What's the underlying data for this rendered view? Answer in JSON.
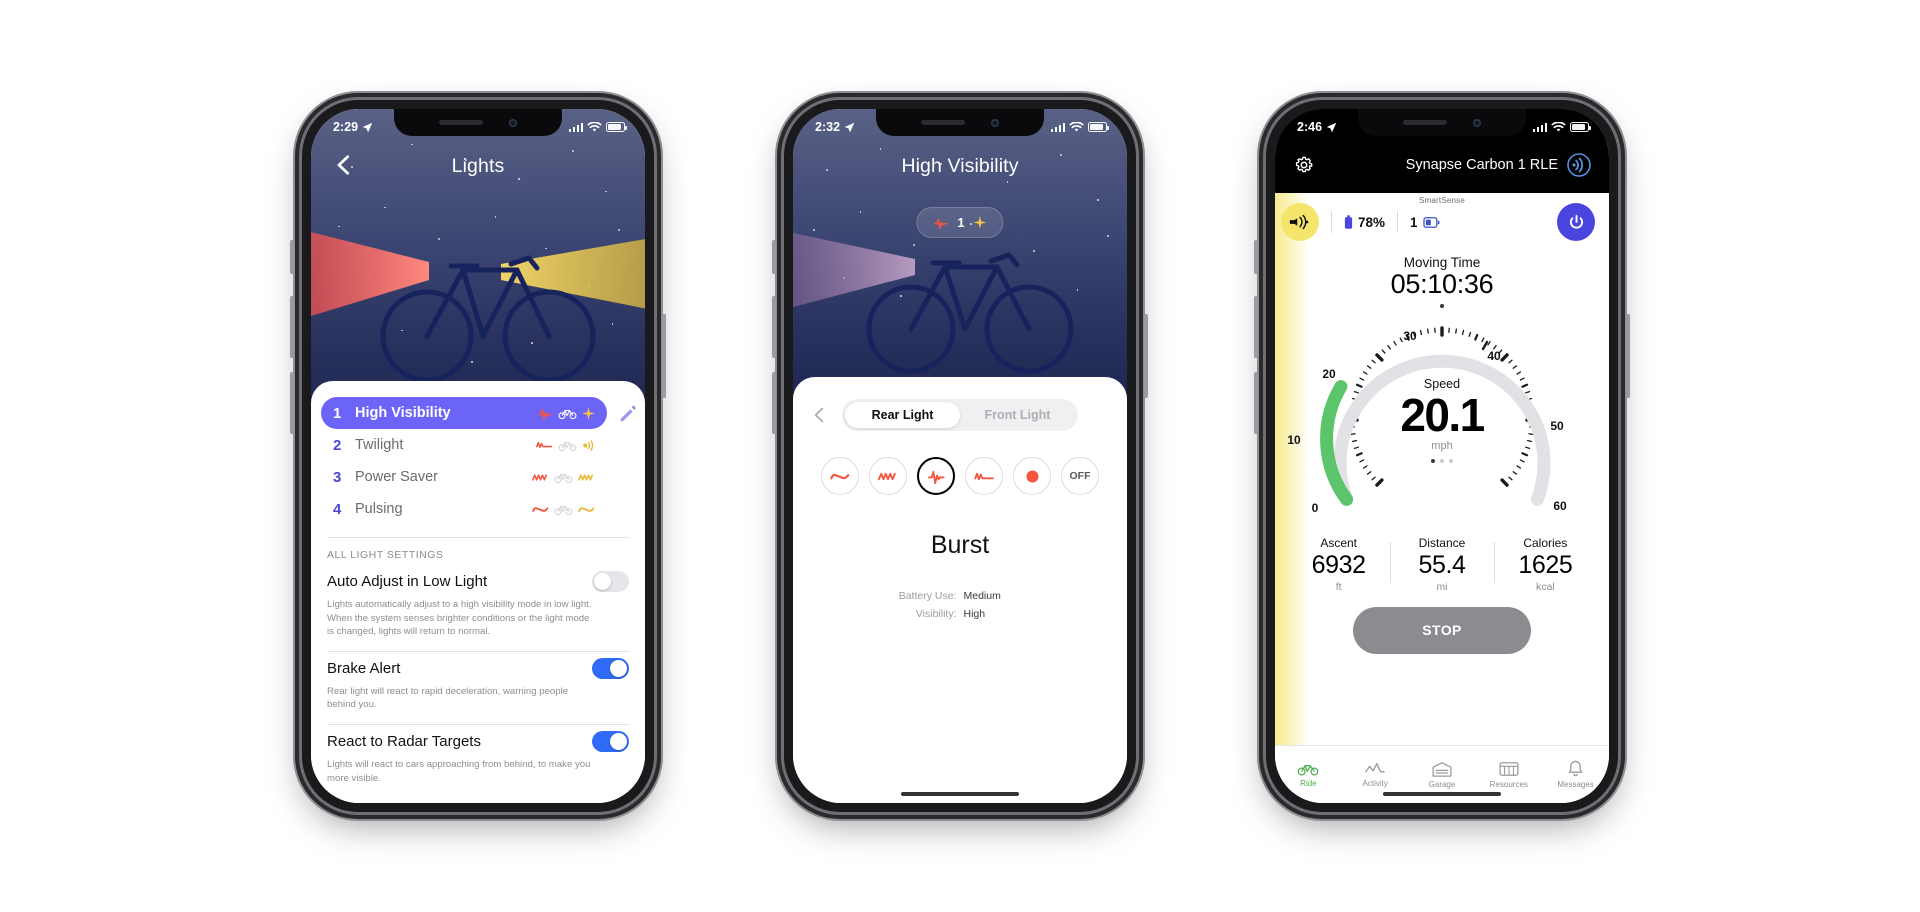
{
  "phone1": {
    "status": {
      "time": "2:29",
      "location_icon": "location-arrow-icon"
    },
    "nav": {
      "title": "Lights",
      "back_icon": "back-chevron-icon"
    },
    "modes": [
      {
        "num": "1",
        "name": "High Visibility",
        "active": true,
        "icons": [
          "burst-wave-icon",
          "bike-icon",
          "sparkle-icon"
        ]
      },
      {
        "num": "2",
        "name": "Twilight",
        "active": false,
        "icons": [
          "pulse-wave-icon",
          "bike-icon",
          "beam-icon"
        ]
      },
      {
        "num": "3",
        "name": "Power Saver",
        "active": false,
        "icons": [
          "zigzag-wave-icon",
          "bike-icon",
          "zigzag-wave-icon"
        ]
      },
      {
        "num": "4",
        "name": "Pulsing",
        "active": false,
        "icons": [
          "sine-wave-icon",
          "bike-icon",
          "sine-wave-yellow-icon"
        ]
      }
    ],
    "edit_icon": "pencil-edit-icon",
    "section_label": "ALL LIGHT SETTINGS",
    "settings": [
      {
        "title": "Auto Adjust in Low Light",
        "desc": "Lights automatically adjust to a high visibility mode in low light. When the system senses brighter conditions or the light mode is changed, lights will return to normal.",
        "enabled": false
      },
      {
        "title": "Brake Alert",
        "desc": "Rear light will react to rapid deceleration, warning people behind you.",
        "enabled": true
      },
      {
        "title": "React to Radar Targets",
        "desc": "Lights will react to cars approaching from behind, to make you more visible.",
        "enabled": true
      }
    ]
  },
  "phone2": {
    "status": {
      "time": "2:32",
      "location_icon": "location-arrow-icon"
    },
    "nav": {
      "title": "High Visibility",
      "back_icon": "back-chevron-icon"
    },
    "chip": {
      "count": "1",
      "left_icon": "burst-wave-icon",
      "right_icon": "sparkle-icon"
    },
    "segments": [
      {
        "label": "Rear Light",
        "active": true
      },
      {
        "label": "Front Light",
        "active": false
      }
    ],
    "patterns": [
      {
        "name": "sine-wave-icon",
        "selected": false,
        "label": ""
      },
      {
        "name": "zigzag-wave-icon",
        "selected": false,
        "label": ""
      },
      {
        "name": "burst-wave-icon",
        "selected": true,
        "label": ""
      },
      {
        "name": "pulse-wave-icon",
        "selected": false,
        "label": ""
      },
      {
        "name": "solid-dot-icon",
        "selected": false,
        "label": ""
      },
      {
        "name": "off-icon",
        "selected": false,
        "label": "OFF"
      }
    ],
    "selected_pattern_name": "Burst",
    "details": [
      {
        "key": "Battery Use:",
        "value": "Medium"
      },
      {
        "key": "Visibility:",
        "value": "High"
      }
    ]
  },
  "phone3": {
    "status": {
      "time": "2:46",
      "location_icon": "location-arrow-icon"
    },
    "header": {
      "gear_icon": "gear-icon",
      "title": "Synapse Carbon 1 RLE",
      "sensor_icon": "radar-sensor-icon"
    },
    "smartsense": {
      "label": "SmartSense",
      "radar_icon": "radar-light-icon",
      "battery_text": "78%",
      "battery_icon": "battery-vertical-icon",
      "device_count": "1",
      "device_icon": "device-battery-icon",
      "power_icon": "power-button-icon"
    },
    "moving_time": {
      "label": "Moving Time",
      "value": "05:10:36"
    },
    "page_dots": {
      "total": 1,
      "active": 0
    },
    "gauge": {
      "label": "Speed",
      "value": "20.1",
      "unit": "mph",
      "ticks": [
        "0",
        "10",
        "20",
        "30",
        "40",
        "50",
        "60"
      ],
      "min": 0,
      "max": 60,
      "arc_color": "#5cc46a",
      "track_color": "#e0e0e4",
      "carousel_dots": {
        "total": 3,
        "active": 0
      }
    },
    "stats": [
      {
        "label": "Ascent",
        "value": "6932",
        "unit": "ft"
      },
      {
        "label": "Distance",
        "value": "55.4",
        "unit": "mi"
      },
      {
        "label": "Calories",
        "value": "1625",
        "unit": "kcal"
      }
    ],
    "stop_button": "STOP",
    "tabs": [
      {
        "label": "Ride",
        "icon": "bike-icon",
        "active": true
      },
      {
        "label": "Activity",
        "icon": "chart-icon",
        "active": false
      },
      {
        "label": "Garage",
        "icon": "garage-icon",
        "active": false
      },
      {
        "label": "Resources",
        "icon": "resources-icon",
        "active": false
      },
      {
        "label": "Messages",
        "icon": "bell-icon",
        "active": false
      }
    ]
  },
  "chart_data": {
    "type": "gauge",
    "title": "Speed",
    "value": 20.1,
    "unit": "mph",
    "min": 0,
    "max": 60,
    "tick_labels": [
      "0",
      "10",
      "20",
      "30",
      "40",
      "50",
      "60"
    ],
    "arc_color": "#5cc46a",
    "track_color": "#e0e0e4"
  }
}
